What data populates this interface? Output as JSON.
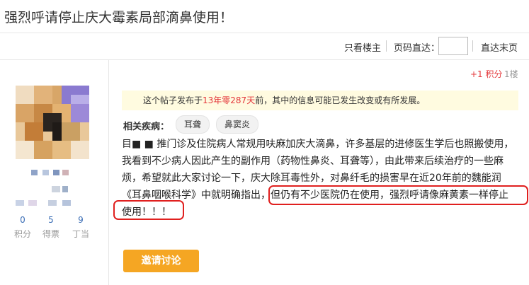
{
  "thread": {
    "title": "强烈呼请停止庆大霉素局部滴鼻使用！"
  },
  "toolbar": {
    "only_op_label": "只看楼主",
    "page_jump_label": "页码直达：",
    "page_jump_value": "",
    "last_page_label": "直达末页"
  },
  "author": {
    "stats": [
      {
        "value": "0",
        "label": "积分"
      },
      {
        "value": "5",
        "label": "得票"
      },
      {
        "value": "9",
        "label": "丁当"
      }
    ]
  },
  "post": {
    "points_label": "+1 积分",
    "floor": "1楼",
    "notice_prefix": "这个帖子发布于",
    "notice_age": "13年零287天",
    "notice_suffix": "前，其中的信息可能已发生改变或有所发展。",
    "tags_label": "相关疾病：",
    "tags": [
      "耳聋",
      "鼻窦炎"
    ],
    "body_lines": [
      "目■ ■ 推门诊及住院病人常规用呋麻加庆大滴鼻，许多基层的进修医生学后也照搬使用，",
      "我看到不少病人因此产生的副作用（药物性鼻炎、耳聋等），由此带来后续治疗的一些麻",
      "烦，希望就此大家讨论一下，庆大除耳毒性外，对鼻纤毛的损害早在近20年前的魏能润",
      "《耳鼻咽喉科学》中就明确指出，但仍有不少医院仍在使用，强烈呼请像麻黄素一样停止",
      "使用！！！"
    ],
    "invite_label": "邀请讨论"
  },
  "colors": {
    "accent": "#f5a623",
    "highlight": "#e0201f",
    "notice_bg": "#fffbe0",
    "link": "#3a6db5"
  }
}
